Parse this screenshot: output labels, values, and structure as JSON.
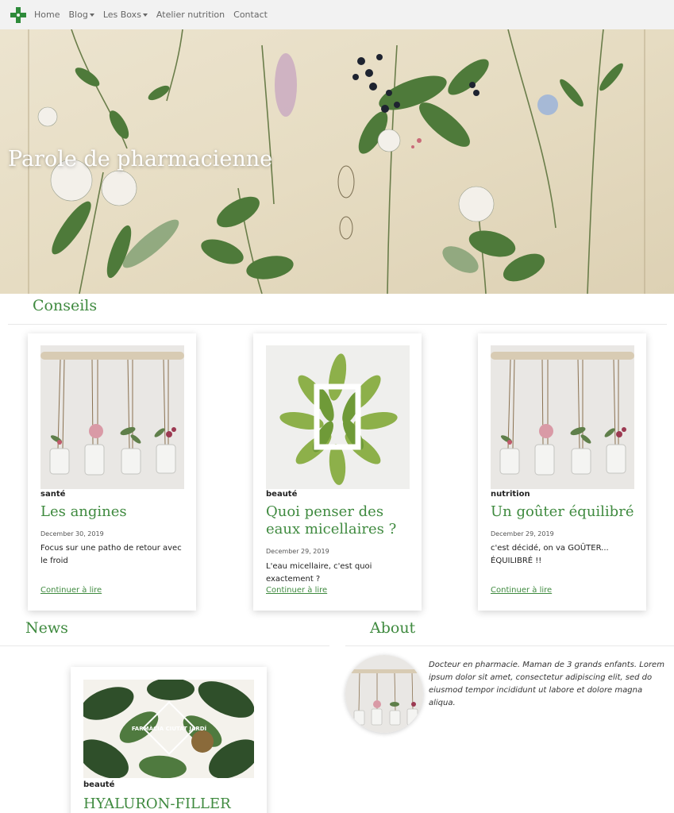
{
  "nav": {
    "items": [
      {
        "label": "Home",
        "dropdown": false
      },
      {
        "label": "Blog",
        "dropdown": true
      },
      {
        "label": "Les Boxs",
        "dropdown": true
      },
      {
        "label": "Atelier nutrition",
        "dropdown": false
      },
      {
        "label": "Contact",
        "dropdown": false
      }
    ]
  },
  "hero": {
    "title": "Parole de pharmacienne"
  },
  "conseils": {
    "title": "Conseils",
    "cards": [
      {
        "category": "santé",
        "title": "Les angines",
        "date": "December 30, 2019",
        "excerpt": "Focus sur une patho de retour avec le froid",
        "more": "Continuer à lire"
      },
      {
        "category": "beauté",
        "title": "Quoi penser des eaux micellaires ?",
        "date": "December 29, 2019",
        "excerpt": "L'eau micellaire, c'est quoi exactement ?",
        "more": "Continuer à lire"
      },
      {
        "category": "nutrition",
        "title": "Un goûter équilibré",
        "date": "December 29, 2019",
        "excerpt": "c'est décidé, on va GOÛTER... ÉQUILIBRÉ !!",
        "more": "Continuer à lire"
      }
    ]
  },
  "news": {
    "title": "News",
    "card": {
      "category": "beauté",
      "title": "HYALURON-FILLER",
      "logo_text": "FARMÀCIA CIUTAT JARDÍ"
    }
  },
  "about": {
    "title": "About",
    "text": "Docteur en pharmacie. Maman de 3 grands enfants. Lorem ipsum dolor sit amet, consectetur adipiscing elit, sed do eiusmod tempor incididunt ut labore et dolore magna aliqua."
  },
  "colors": {
    "accent": "#3f8a3f",
    "nav_bg": "#f2f2f2",
    "logo_cross": "#2e8b3a"
  }
}
